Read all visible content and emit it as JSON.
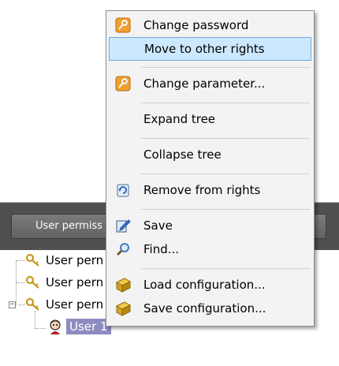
{
  "toolbar": {
    "button_label": "User permiss"
  },
  "tree": {
    "nodes": [
      {
        "label": "User pern"
      },
      {
        "label": "User pern"
      },
      {
        "label": "User pern"
      }
    ],
    "selected_user": "User 1"
  },
  "context_menu": {
    "items": [
      {
        "label": "Change password",
        "icon": "key-icon"
      },
      {
        "label": "Move to other rights",
        "icon": null
      },
      {
        "label": "Change parameter...",
        "icon": "key-icon"
      },
      {
        "label": "Expand tree",
        "icon": null
      },
      {
        "label": "Collapse tree",
        "icon": null
      },
      {
        "label": "Remove from rights",
        "icon": "remove-icon"
      },
      {
        "label": "Save",
        "icon": "save-icon"
      },
      {
        "label": "Find...",
        "icon": "magnifier-icon"
      },
      {
        "label": "Load configuration...",
        "icon": "box-icon"
      },
      {
        "label": "Save configuration...",
        "icon": "box-icon"
      }
    ],
    "highlighted": "Move to other rights"
  },
  "colors": {
    "menu_bg": "#f3f3f3",
    "highlight_bg": "#cce8ff",
    "highlight_border": "#6fa9dc",
    "band": "#505050",
    "selected_node": "#8c8cc0"
  }
}
